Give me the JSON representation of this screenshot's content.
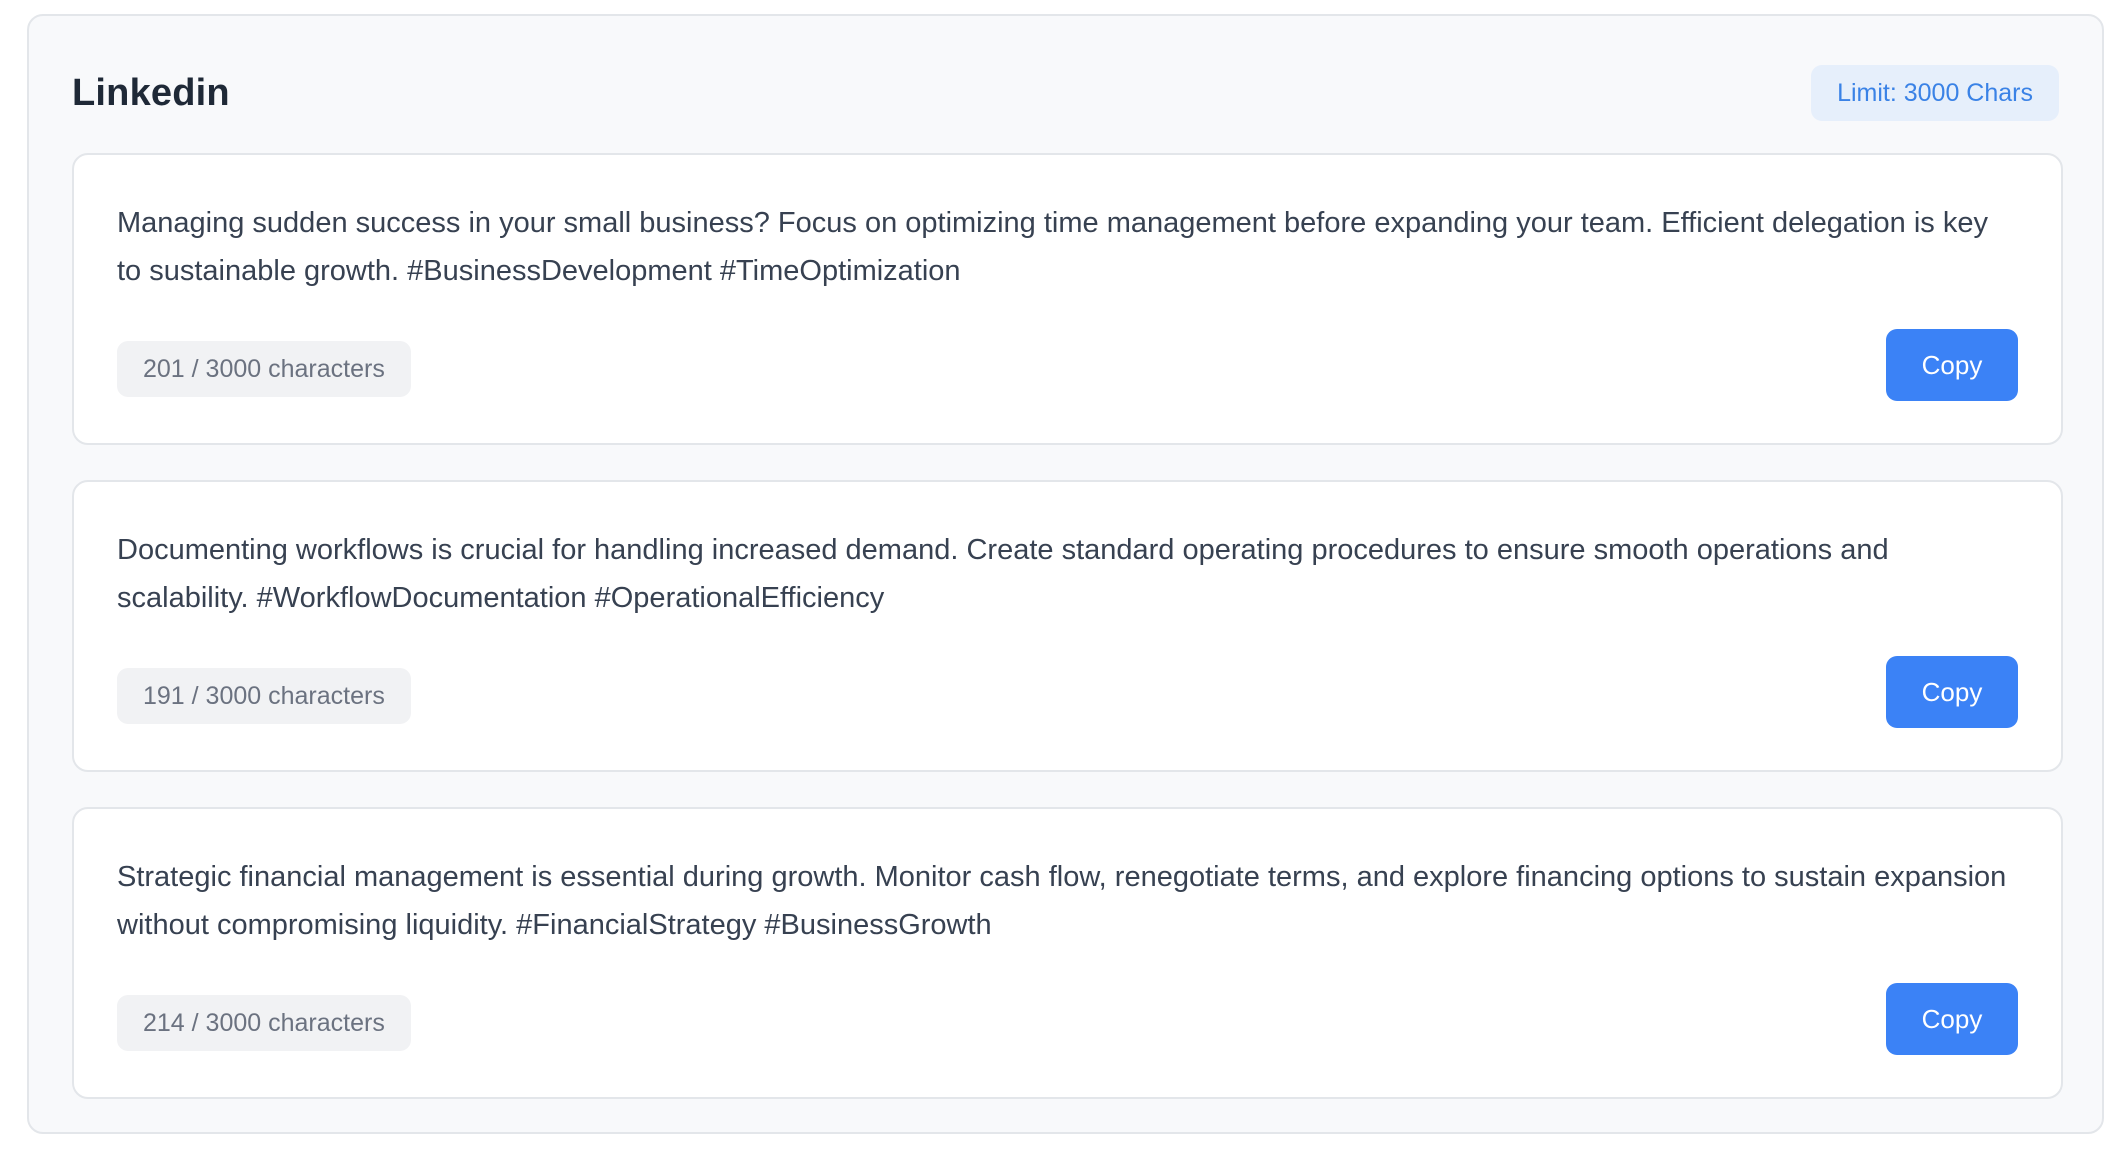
{
  "panel": {
    "title": "Linkedin",
    "limit_label": "Limit: 3000 Chars"
  },
  "posts": [
    {
      "text": "Managing sudden success in your small business? Focus on optimizing time management before expanding your team. Efficient delegation is key to sustainable growth. #BusinessDevelopment #TimeOptimization",
      "char_count": "201 / 3000 characters",
      "copy_label": "Copy"
    },
    {
      "text": "Documenting workflows is crucial for handling increased demand. Create standard operating procedures to ensure smooth operations and scalability. #WorkflowDocumentation #OperationalEfficiency",
      "char_count": "191 / 3000 characters",
      "copy_label": "Copy"
    },
    {
      "text": "Strategic financial management is essential during growth. Monitor cash flow, renegotiate terms, and explore financing options to sustain expansion without compromising liquidity. #FinancialStrategy #BusinessGrowth",
      "char_count": "214 / 3000 characters",
      "copy_label": "Copy"
    }
  ],
  "colors": {
    "accent": "#3b82f6",
    "badge_text": "#3a82e6",
    "badge_bg": "#e6effb",
    "panel_bg": "#f8f9fb"
  }
}
